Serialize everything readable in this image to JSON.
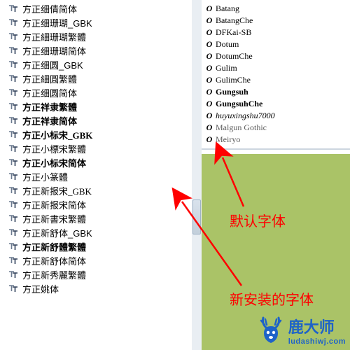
{
  "left_fonts": [
    {
      "label": "方正细倩简体",
      "bold": false,
      "serif": false
    },
    {
      "label": "方正细珊瑚_GBK",
      "bold": false,
      "serif": false
    },
    {
      "label": "方正細珊瑚繁體",
      "bold": false,
      "serif": true
    },
    {
      "label": "方正细珊瑚简体",
      "bold": false,
      "serif": false
    },
    {
      "label": "方正细圆_GBK",
      "bold": false,
      "serif": false
    },
    {
      "label": "方正細圓繁體",
      "bold": false,
      "serif": true
    },
    {
      "label": "方正细圆简体",
      "bold": false,
      "serif": false
    },
    {
      "label": "方正祥隶繁體",
      "bold": true,
      "serif": true
    },
    {
      "label": "方正祥隶简体",
      "bold": true,
      "serif": false
    },
    {
      "label": "方正小标宋_GBK",
      "bold": true,
      "serif": true
    },
    {
      "label": "方正小標宋繁體",
      "bold": false,
      "serif": true
    },
    {
      "label": "方正小标宋简体",
      "bold": true,
      "serif": true
    },
    {
      "label": "方正小篆體",
      "bold": false,
      "serif": true
    },
    {
      "label": "方正新报宋_GBK",
      "bold": false,
      "serif": true
    },
    {
      "label": "方正新报宋简体",
      "bold": false,
      "serif": true
    },
    {
      "label": "方正新書宋繁體",
      "bold": false,
      "serif": true
    },
    {
      "label": "方正新舒体_GBK",
      "bold": false,
      "serif": false
    },
    {
      "label": "方正新舒體繁體",
      "bold": true,
      "serif": true
    },
    {
      "label": "方正新舒体简体",
      "bold": false,
      "serif": false
    },
    {
      "label": "方正新秀麗繁體",
      "bold": false,
      "serif": true
    },
    {
      "label": "方正姚体",
      "bold": false,
      "serif": false
    }
  ],
  "right_fonts": [
    {
      "label": "Batang"
    },
    {
      "label": "BatangChe"
    },
    {
      "label": "DFKai-SB"
    },
    {
      "label": "Dotum"
    },
    {
      "label": "DotumChe"
    },
    {
      "label": "Gulim"
    },
    {
      "label": "GulimChe"
    },
    {
      "label": "Gungsuh",
      "bold": true
    },
    {
      "label": "GungsuhChe",
      "bold": true
    },
    {
      "label": "huyuxingshu7000",
      "script": true
    },
    {
      "label": "Malgun Gothic",
      "truncated": true
    },
    {
      "label": "Meiryo",
      "truncated": true
    }
  ],
  "annotations": {
    "default_font": "默认字体",
    "new_installed_font": "新安装的字体"
  },
  "watermark": {
    "text": "鹿大师",
    "url": "ludashiwj.com"
  },
  "colors": {
    "accent_red": "#ff0000",
    "green_bg": "#aac367",
    "brand_blue": "#1e63c8"
  }
}
